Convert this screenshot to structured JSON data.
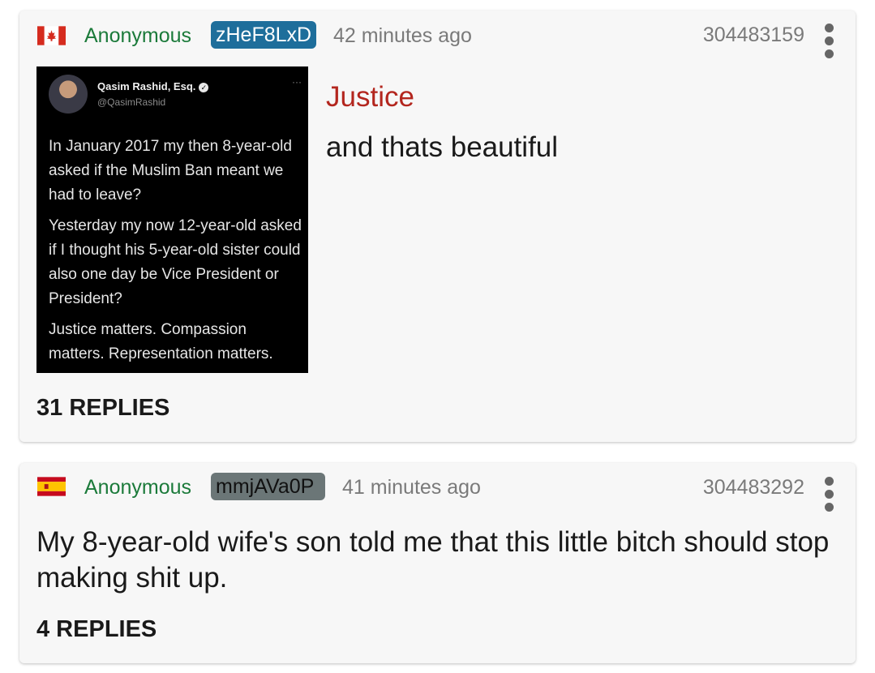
{
  "posts": [
    {
      "flag": "canada-flag",
      "name": "Anonymous",
      "poster_id": "zHeF8LxD",
      "time": "42 minutes ago",
      "post_number": "304483159",
      "subject": "Justice",
      "comment": "and thats beautiful",
      "replies": "31 REPLIES",
      "id_color": "#1e6e9b",
      "image": {
        "tweet_name": "Qasim Rashid, Esq.",
        "tweet_handle": "@QasimRashid",
        "tweet_more": "···",
        "tweet_paragraphs": [
          "In January 2017 my then 8-year-old asked if the Muslim Ban meant we had to leave?",
          "Yesterday my now 12-year-old asked if I thought his 5-year-old sister could also one day be Vice President or President?",
          "Justice matters. Compassion matters. Representation matters."
        ]
      }
    },
    {
      "flag": "spain-flag",
      "name": "Anonymous",
      "poster_id": "mmjAVa0P",
      "time": "41 minutes ago",
      "post_number": "304483292",
      "comment": "My 8-year-old wife's son told me that this little bitch should stop making shit up.",
      "replies": "4 REPLIES",
      "id_color": "#6b7677"
    }
  ],
  "colors": {
    "name": "#1b7a3a",
    "subject": "#b3261e",
    "meta": "#7a7a7a",
    "card_background": "#f7f7f7"
  }
}
